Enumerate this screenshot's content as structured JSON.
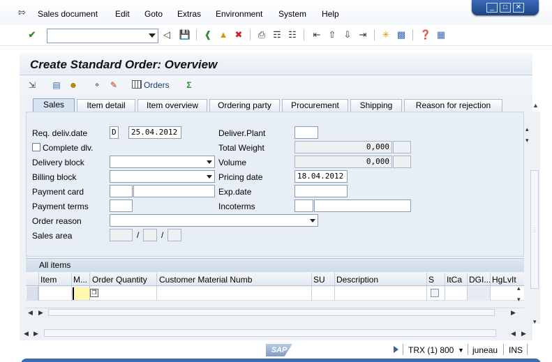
{
  "menu": {
    "items": [
      "Sales document",
      "Edit",
      "Goto",
      "Extras",
      "Environment",
      "System",
      "Help"
    ]
  },
  "toolbar": {
    "command_value": "",
    "icons": [
      "enter-icon",
      "back-icon",
      "save-icon",
      "back-arrow-icon",
      "exit-icon",
      "cancel-icon",
      "print-icon",
      "find-icon",
      "find-next-icon",
      "first-page-icon",
      "prev-page-icon",
      "next-page-icon",
      "last-page-icon",
      "new-session-icon",
      "shortcut-icon",
      "help-icon",
      "layout-icon"
    ]
  },
  "title": "Create Standard Order: Overview",
  "apptoolbar": {
    "orders_label": "Orders"
  },
  "tabs": [
    "Sales",
    "Item detail",
    "Item overview",
    "Ordering party",
    "Procurement",
    "Shipping",
    "Reason for rejection"
  ],
  "form": {
    "req_deliv_date_label": "Req. deliv.date",
    "req_deliv_date_type": "D",
    "req_deliv_date_value": "25.04.2012",
    "complete_dlv_label": "Complete dlv.",
    "delivery_block_label": "Delivery block",
    "billing_block_label": "Billing block",
    "payment_card_label": "Payment card",
    "payment_terms_label": "Payment terms",
    "order_reason_label": "Order reason",
    "sales_area_label": "Sales area",
    "sales_area_sep": "/",
    "deliver_plant_label": "Deliver.Plant",
    "total_weight_label": "Total Weight",
    "total_weight_value": "0,000",
    "volume_label": "Volume",
    "volume_value": "0,000",
    "pricing_date_label": "Pricing date",
    "pricing_date_value": "18.04.2012",
    "exp_date_label": "Exp.date",
    "incoterms_label": "Incoterms"
  },
  "table": {
    "title": "All items",
    "columns": [
      "Item",
      "M...",
      "Order Quantity",
      "Customer Material Numb",
      "SU",
      "Description",
      "S",
      "ItCa",
      "DGI...",
      "HgLvIt"
    ]
  },
  "status": {
    "system": "TRX (1) 800",
    "user": "juneau",
    "mode": "INS",
    "logo": "SAP"
  }
}
